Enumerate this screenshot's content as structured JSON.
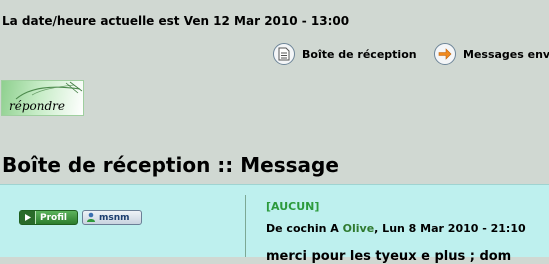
{
  "header": {
    "datetime": "La date/heure actuelle est Ven 12 Mar 2010 - 13:00"
  },
  "nav": {
    "inbox_label": "Boîte de réception",
    "sent_label": "Messages env"
  },
  "reply_button": {
    "label": "répondre"
  },
  "page_title": "Boîte de réception :: Message",
  "message": {
    "subject": "[AUCUN]",
    "meta_prefix": "De cochin A",
    "recipient": "Olive",
    "meta_date": ", Lun 8 Mar 2010 - 21:10",
    "body_preview": "merci pour les tyeux e plus ; dom",
    "profile_button": "Profil",
    "msnm_button": "msnm"
  }
}
